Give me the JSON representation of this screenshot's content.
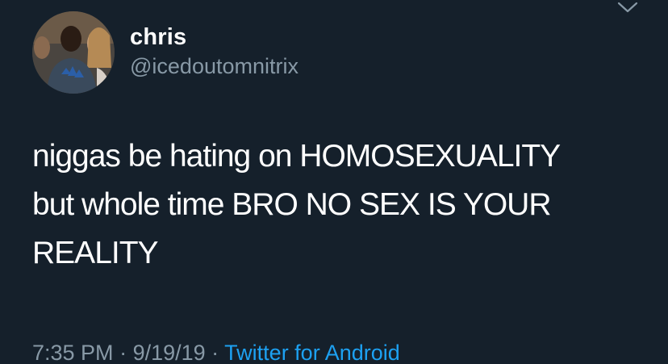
{
  "tweet": {
    "author": {
      "name": "chris",
      "handle": "@icedoutomnitrix"
    },
    "text_lines": [
      "niggas be hating on HOMOSEXUALITY",
      "but whole time BRO NO SEX IS YOUR",
      "REALITY"
    ],
    "meta": {
      "time": "7:35 PM",
      "sep1": " · ",
      "date": "9/19/19",
      "sep2": " · ",
      "source": "Twitter for Android"
    }
  },
  "icons": {
    "menu": "chevron-down-icon"
  },
  "colors": {
    "background": "#15202b",
    "primary_text": "#ffffff",
    "secondary_text": "#8899a6",
    "link": "#1da1f2"
  }
}
